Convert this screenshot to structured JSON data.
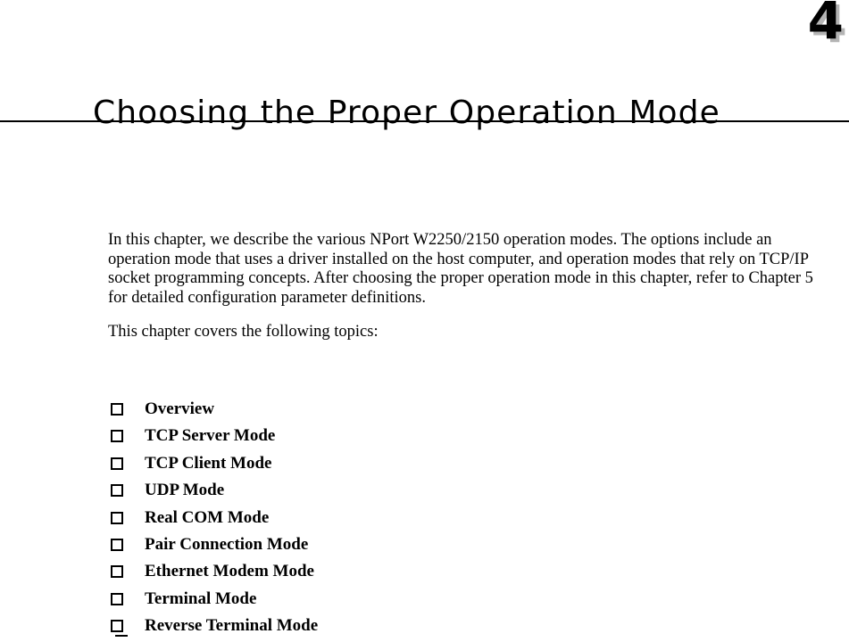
{
  "document": {
    "chapter_number": "4",
    "chapter_title": "Choosing the Proper Operation Mode"
  },
  "body": {
    "intro_paragraph": "In this chapter, we describe the various NPort W2250/2150 operation modes. The options include an operation mode that uses a driver installed on the host computer, and operation modes that rely on TCP/IP socket programming concepts. After choosing the proper operation mode in this chapter, refer to Chapter 5 for detailed configuration parameter definitions.",
    "topics_lead": "This chapter covers the following topics:"
  },
  "topics": [
    {
      "label": "Overview"
    },
    {
      "label": "TCP Server Mode"
    },
    {
      "label": "TCP Client Mode"
    },
    {
      "label": "UDP Mode"
    },
    {
      "label": "Real COM Mode"
    },
    {
      "label": "Pair Connection Mode"
    },
    {
      "label": "Ethernet Modem Mode"
    },
    {
      "label": "Terminal Mode"
    },
    {
      "label": "Reverse Terminal Mode"
    }
  ],
  "colors": {
    "text": "#000000",
    "page_background": "#ffffff",
    "rule": "#000000",
    "chapter_number_shadow": "#b4b4b4"
  }
}
